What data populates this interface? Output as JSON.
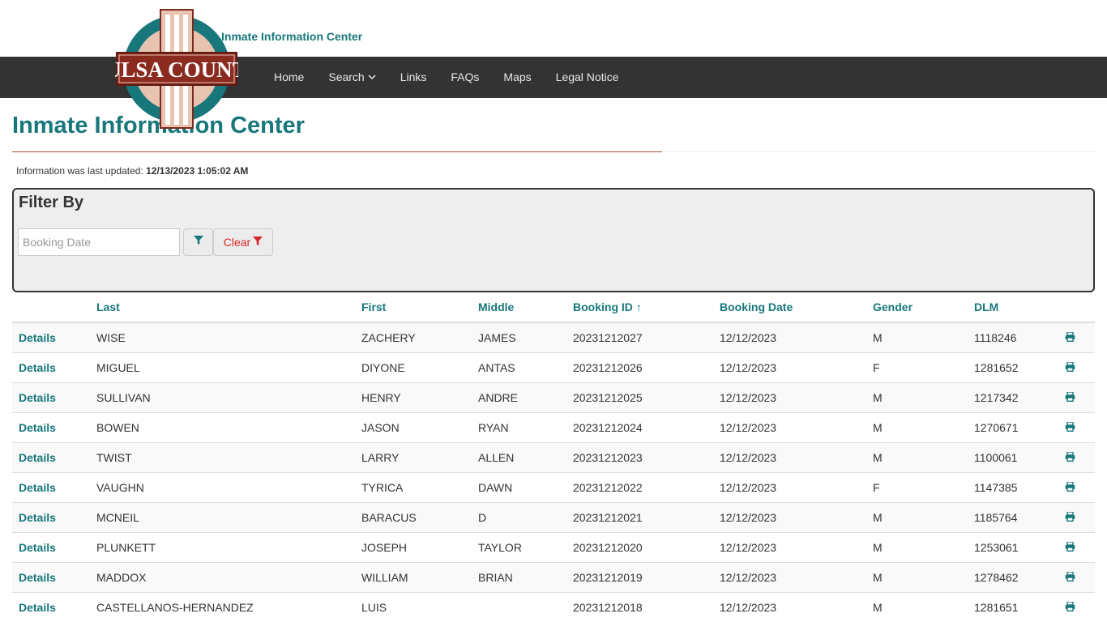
{
  "header": {
    "site_title": "Inmate Information Center",
    "logo_text": "TULSA COUNTY"
  },
  "nav": {
    "items": [
      "Home",
      "Search",
      "Links",
      "FAQs",
      "Maps",
      "Legal Notice"
    ]
  },
  "page": {
    "title": "Inmate Information Center",
    "updated_label": "Information was last updated:",
    "updated_value": "12/13/2023 1:05:02 AM"
  },
  "filter": {
    "title": "Filter By",
    "date_placeholder": "Booking Date",
    "date_value": "",
    "clear_label": "Clear"
  },
  "table": {
    "columns": [
      "",
      "Last",
      "First",
      "Middle",
      "Booking ID ↑",
      "Booking Date",
      "Gender",
      "DLM",
      ""
    ],
    "details_label": "Details",
    "rows": [
      [
        "WISE",
        "ZACHERY",
        "JAMES",
        "20231212027",
        "12/12/2023",
        "M",
        "1118246"
      ],
      [
        "MIGUEL",
        "DIYONE",
        "ANTAS",
        "20231212026",
        "12/12/2023",
        "F",
        "1281652"
      ],
      [
        "SULLIVAN",
        "HENRY",
        "ANDRE",
        "20231212025",
        "12/12/2023",
        "M",
        "1217342"
      ],
      [
        "BOWEN",
        "JASON",
        "RYAN",
        "20231212024",
        "12/12/2023",
        "M",
        "1270671"
      ],
      [
        "TWIST",
        "LARRY",
        "ALLEN",
        "20231212023",
        "12/12/2023",
        "M",
        "1100061"
      ],
      [
        "VAUGHN",
        "TYRICA",
        "DAWN",
        "20231212022",
        "12/12/2023",
        "F",
        "1147385"
      ],
      [
        "MCNEIL",
        "BARACUS",
        "D",
        "20231212021",
        "12/12/2023",
        "M",
        "1185764"
      ],
      [
        "PLUNKETT",
        "JOSEPH",
        "TAYLOR",
        "20231212020",
        "12/12/2023",
        "M",
        "1253061"
      ],
      [
        "MADDOX",
        "WILLIAM",
        "BRIAN",
        "20231212019",
        "12/12/2023",
        "M",
        "1278462"
      ],
      [
        "CASTELLANOS-HERNANDEZ",
        "LUIS",
        "",
        "20231212018",
        "12/12/2023",
        "M",
        "1281651"
      ]
    ]
  },
  "icons": {
    "filter": "filter-icon",
    "clear": "filter-icon",
    "print": "print-icon",
    "dropdown": "chevron-down-icon"
  },
  "colors": {
    "accent": "#17777b",
    "navbar": "#333333",
    "clear_red": "#d9262a",
    "rule_brown": "#a0522d"
  }
}
